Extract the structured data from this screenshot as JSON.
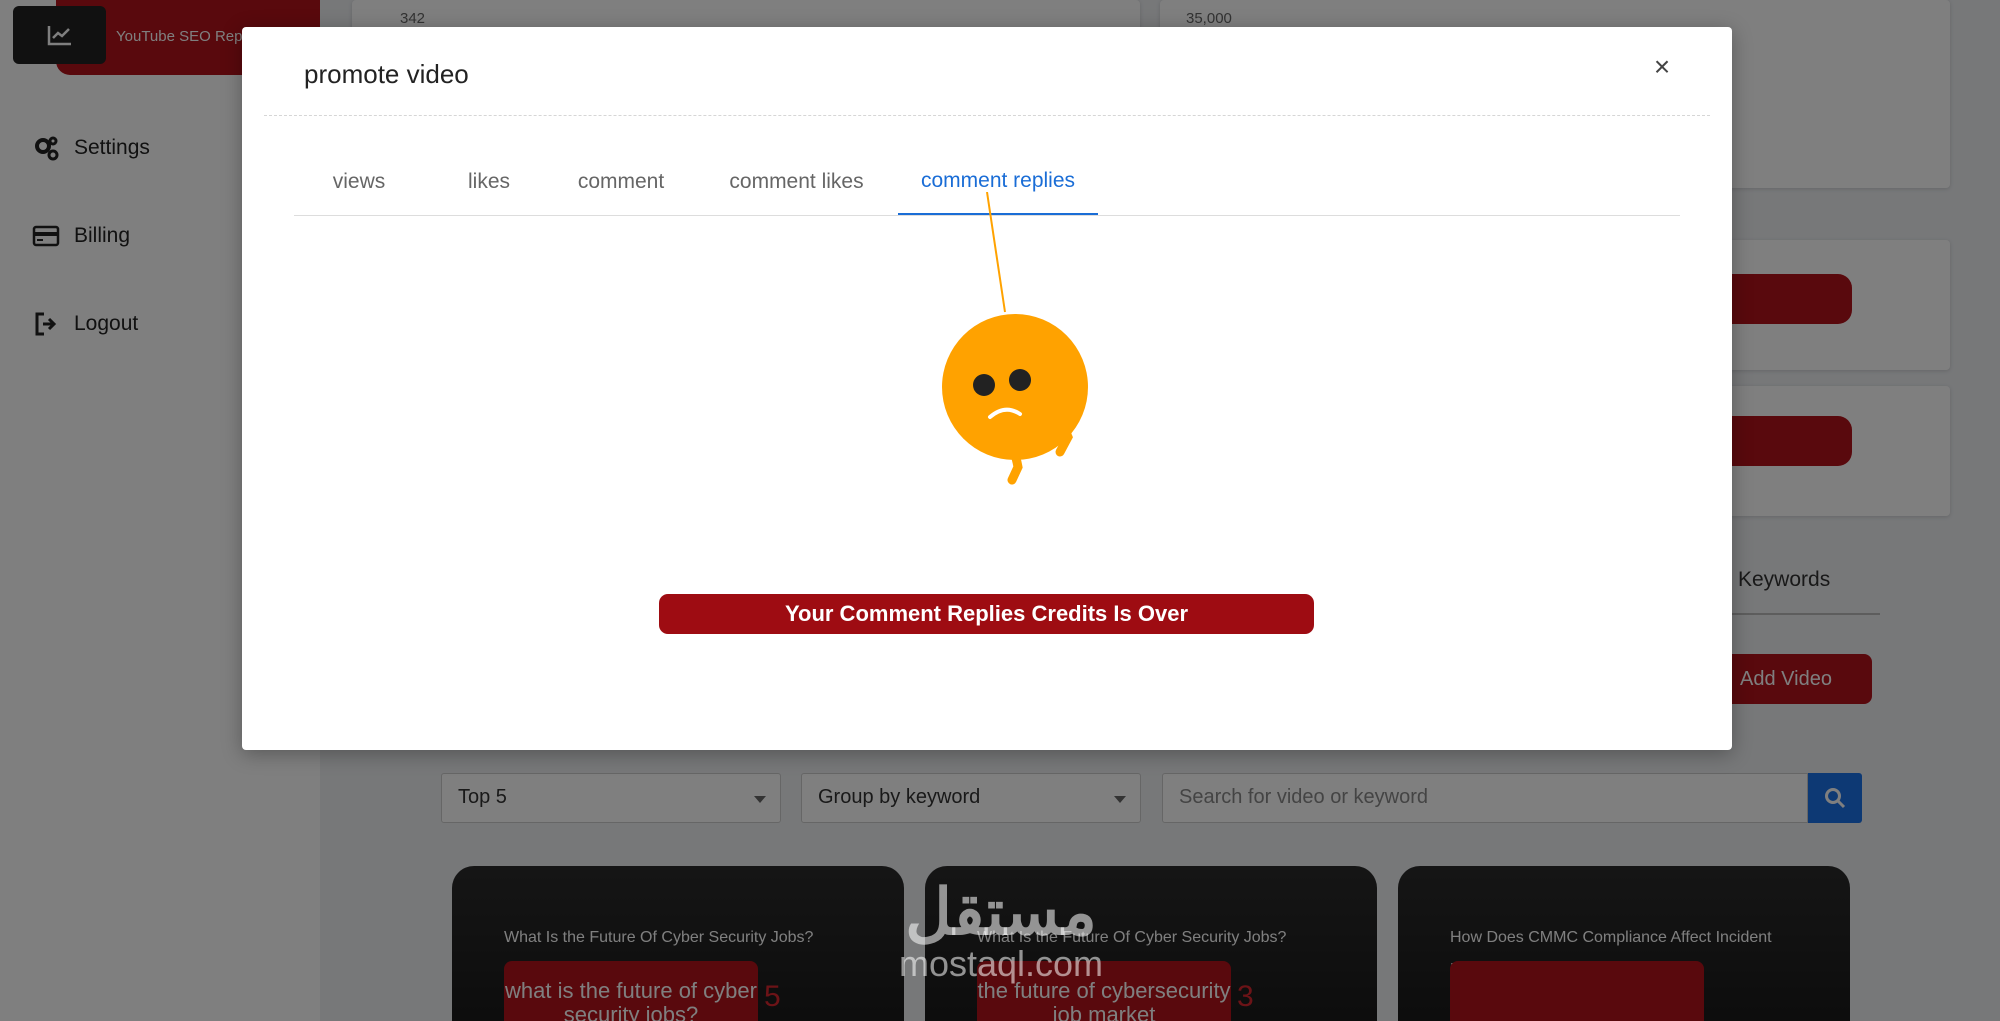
{
  "sidebar": {
    "report_tab": "YouTube SEO Rep",
    "items": [
      {
        "label": "Settings",
        "icon": "gears-icon"
      },
      {
        "label": "Billing",
        "icon": "credit-card-icon"
      },
      {
        "label": "Logout",
        "icon": "logout-icon"
      }
    ]
  },
  "background": {
    "chart_left_tick": "342",
    "chart_right_tick": "35,000",
    "keywords_tab": "Keywords",
    "add_video_label": "Add Video",
    "filter_top": "Top 5",
    "filter_group": "Group by keyword",
    "search_placeholder": "Search for video or keyword",
    "videos": [
      {
        "title": "What Is the Future Of Cyber Security Jobs?",
        "keyword": "what is the future of cyber security jobs?",
        "rank": "5"
      },
      {
        "title": "What Is the Future Of Cyber Security Jobs?",
        "keyword": "the future of cybersecurity job market",
        "rank": "3"
      },
      {
        "title": "How Does CMMC Compliance Affect Incident Reporting In Defense?",
        "keyword": "",
        "rank": ""
      }
    ]
  },
  "modal": {
    "title": "promote video",
    "close_symbol": "×",
    "tabs": [
      "views",
      "likes",
      "comment",
      "comment likes",
      "comment replies"
    ],
    "active_tab": "comment replies",
    "message": "Your Comment Replies Credits Is Over"
  },
  "watermark": {
    "arabic": "مستقل",
    "latin": "mostaql.com"
  },
  "colors": {
    "brand_red": "#b3121a",
    "banner_red": "#9e0c12",
    "tab_active": "#1a6dd6",
    "mascot": "#ffa200",
    "search_blue": "#1a73e8"
  }
}
